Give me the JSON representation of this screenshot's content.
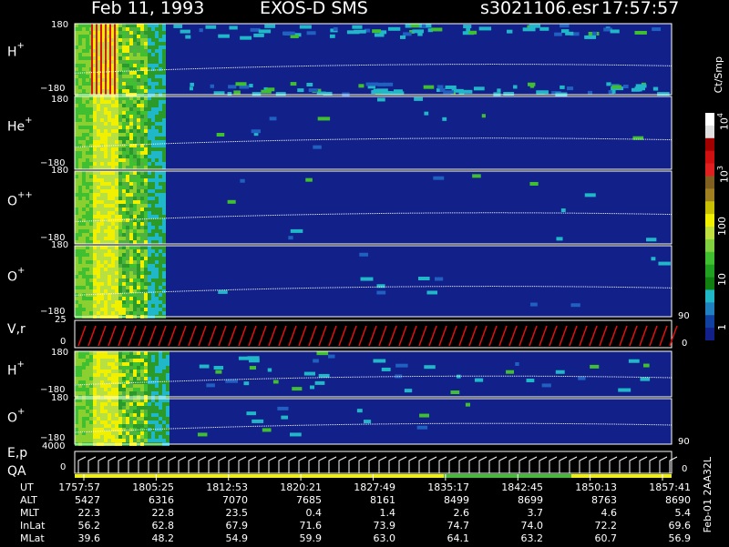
{
  "header": {
    "date": "Feb 11, 1993",
    "mission": "EXOS-D SMS",
    "file": "s3021106.esr",
    "time": "17:57:57"
  },
  "panels": [
    {
      "species": "H",
      "charge": "+",
      "ymax": "180",
      "ymin": "−180"
    },
    {
      "species": "He",
      "charge": "+",
      "ymax": "180",
      "ymin": "−180"
    },
    {
      "species": "O",
      "charge": "++",
      "ymax": "180",
      "ymin": "−180"
    },
    {
      "species": "O",
      "charge": "+",
      "ymax": "180",
      "ymin": "−180"
    },
    {
      "species": "V,r",
      "charge": "",
      "ymax": "25",
      "ymin": "0"
    },
    {
      "species": "H",
      "charge": "+",
      "ymax": "180",
      "ymin": "−180"
    },
    {
      "species": "O",
      "charge": "+",
      "ymax": "180",
      "ymin": "−180"
    },
    {
      "species": "E,p",
      "charge": "",
      "ymax": "4000",
      "ymin": "0"
    }
  ],
  "qa_label": "QA",
  "right_axis": {
    "upper": "90",
    "zero": "0",
    "lower": "90",
    "lower_zero": "0"
  },
  "colorbar": {
    "unit": "Ct/Smp",
    "ticks": [
      "10",
      "3",
      "10",
      "4",
      "100",
      "10",
      "1"
    ],
    "labels": {
      "t1": "1",
      "t10": "10",
      "t100": "100",
      "t1000": "10",
      "t1000_exp": "3",
      "t10000": "10",
      "t10000_exp": "4"
    }
  },
  "ephemeris": {
    "labels": [
      "UT",
      "ALT",
      "MLT",
      "InLat",
      "MLat"
    ],
    "columns": [
      {
        "UT": "1757:57",
        "ALT": "5427",
        "MLT": "22.3",
        "InLat": "56.2",
        "MLat": "39.6"
      },
      {
        "UT": "1805:25",
        "ALT": "6316",
        "MLT": "22.8",
        "InLat": "62.8",
        "MLat": "48.2"
      },
      {
        "UT": "1812:53",
        "ALT": "7070",
        "MLT": "23.5",
        "InLat": "67.9",
        "MLat": "54.9"
      },
      {
        "UT": "1820:21",
        "ALT": "7685",
        "MLT": "0.4",
        "InLat": "71.6",
        "MLat": "59.9"
      },
      {
        "UT": "1827:49",
        "ALT": "8161",
        "MLT": "1.4",
        "InLat": "73.9",
        "MLat": "63.0"
      },
      {
        "UT": "1835:17",
        "ALT": "8499",
        "MLT": "2.6",
        "InLat": "74.7",
        "MLat": "64.1"
      },
      {
        "UT": "1842:45",
        "ALT": "8699",
        "MLT": "3.7",
        "InLat": "74.0",
        "MLat": "63.2"
      },
      {
        "UT": "1850:13",
        "ALT": "8763",
        "MLT": "4.6",
        "InLat": "72.2",
        "MLat": "60.7"
      },
      {
        "UT": "1857:41",
        "ALT": "8690",
        "MLT": "5.4",
        "InLat": "69.6",
        "MLat": "56.9"
      }
    ]
  },
  "footer_id": "Feb-01 2AA32L",
  "chart_data": {
    "type": "heatmap",
    "title": "Feb 11, 1993   EXOS-D SMS",
    "x_tick_labels": [
      "1757:57",
      "1805:25",
      "1812:53",
      "1820:21",
      "1827:49",
      "1835:17",
      "1842:45",
      "1850:13",
      "1857:41"
    ],
    "colorbar_unit": "Ct/Smp",
    "colorbar_range": [
      1,
      10000
    ],
    "colorbar_scale": "log",
    "series": [
      {
        "name": "H+",
        "ylim": [
          -180,
          180
        ]
      },
      {
        "name": "He+",
        "ylim": [
          -180,
          180
        ]
      },
      {
        "name": "O++",
        "ylim": [
          -180,
          180
        ]
      },
      {
        "name": "O+",
        "ylim": [
          -180,
          180
        ]
      },
      {
        "name": "V,r",
        "ylim": [
          0,
          25
        ]
      },
      {
        "name": "H+",
        "ylim": [
          -180,
          180
        ]
      },
      {
        "name": "O+",
        "ylim": [
          -180,
          180
        ]
      },
      {
        "name": "E,p",
        "ylim": [
          0,
          4000
        ]
      }
    ],
    "colors": {
      "background_low": "#12208a",
      "cyan": "#20b8c8",
      "green": "#40c030",
      "yellow": "#f0f000",
      "red": "#e01010",
      "white": "#ffffff"
    }
  }
}
